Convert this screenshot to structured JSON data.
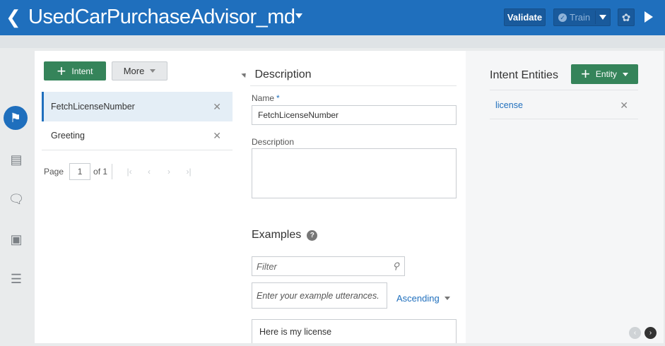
{
  "header": {
    "title": "UsedCarPurchaseAdvisor_md",
    "validate_label": "Validate",
    "train_label": "Train"
  },
  "left_nav": {
    "items": [
      "intents",
      "entities",
      "flows",
      "resources",
      "settings"
    ]
  },
  "intents_panel": {
    "add_label": "Intent",
    "more_label": "More",
    "items": [
      {
        "name": "FetchLicenseNumber",
        "selected": true
      },
      {
        "name": "Greeting",
        "selected": false
      }
    ],
    "pager": {
      "label": "Page",
      "current": "1",
      "of_label": "of 1"
    }
  },
  "description_panel": {
    "section_title": "Description",
    "name_label": "Name",
    "required_mark": "*",
    "name_value": "FetchLicenseNumber",
    "description_label": "Description",
    "description_value": "",
    "examples_title": "Examples",
    "help_icon": "?",
    "filter_placeholder": "Filter",
    "utterance_placeholder": "Enter your example utterances.",
    "sort_label": "Ascending",
    "examples": [
      "Here is my license"
    ]
  },
  "entities_panel": {
    "title": "Intent Entities",
    "add_label": "Entity",
    "items": [
      {
        "name": "license"
      }
    ]
  },
  "colors": {
    "header_blue": "#1f6fbd",
    "green_button": "#35845a",
    "link_blue": "#1f6fbd"
  }
}
